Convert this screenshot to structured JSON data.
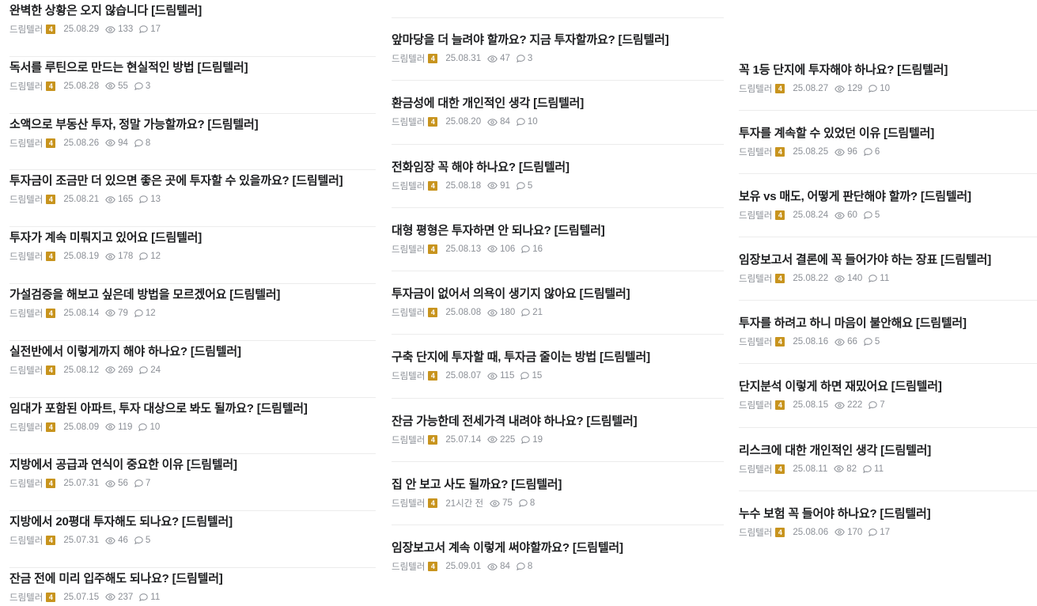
{
  "colors": {
    "title": "#1d1e20",
    "meta": "#8b8f96",
    "level_badge": "#c8941e",
    "divider": "#ececec"
  },
  "icons": {
    "views": "eye-icon",
    "comments": "comment-bubble-icon"
  },
  "columns": [
    {
      "posts": [
        {
          "title": "완벽한 상황은 오지 않습니다 [드림텔러]",
          "author": "드림텔러",
          "level": "4",
          "date": "25.08.29",
          "views": "133",
          "comments": "17"
        },
        {
          "title": "독서를 루틴으로 만드는 현실적인 방법 [드림텔러]",
          "author": "드림텔러",
          "level": "4",
          "date": "25.08.28",
          "views": "55",
          "comments": "3"
        },
        {
          "title": "소액으로 부동산 투자, 정말 가능할까요? [드림텔러]",
          "author": "드림텔러",
          "level": "4",
          "date": "25.08.26",
          "views": "94",
          "comments": "8"
        },
        {
          "title": "투자금이 조금만 더 있으면 좋은 곳에 투자할 수 있을까요? [드림텔러]",
          "author": "드림텔러",
          "level": "4",
          "date": "25.08.21",
          "views": "165",
          "comments": "13"
        },
        {
          "title": "투자가 계속 미뤄지고 있어요 [드림텔러]",
          "author": "드림텔러",
          "level": "4",
          "date": "25.08.19",
          "views": "178",
          "comments": "12"
        },
        {
          "title": "가설검증을 해보고 싶은데 방법을 모르겠어요 [드림텔러]",
          "author": "드림텔러",
          "level": "4",
          "date": "25.08.14",
          "views": "79",
          "comments": "12"
        },
        {
          "title": "실전반에서 이렇게까지 해야 하나요? [드림텔러]",
          "author": "드림텔러",
          "level": "4",
          "date": "25.08.12",
          "views": "269",
          "comments": "24"
        },
        {
          "title": "임대가 포함된 아파트, 투자 대상으로 봐도 될까요? [드림텔러]",
          "author": "드림텔러",
          "level": "4",
          "date": "25.08.09",
          "views": "119",
          "comments": "10"
        },
        {
          "title": "지방에서 공급과 연식이 중요한 이유 [드림텔러]",
          "author": "드림텔러",
          "level": "4",
          "date": "25.07.31",
          "views": "56",
          "comments": "7"
        },
        {
          "title": "지방에서 20평대 투자해도 되나요? [드림텔러]",
          "author": "드림텔러",
          "level": "4",
          "date": "25.07.31",
          "views": "46",
          "comments": "5"
        },
        {
          "title": "잔금 전에 미리 입주해도 되나요? [드림텔러]",
          "author": "드림텔러",
          "level": "4",
          "date": "25.07.15",
          "views": "237",
          "comments": "11"
        }
      ]
    },
    {
      "posts": [
        {
          "title": "앞마당을 더 늘려야 할까요? 지금 투자할까요? [드림텔러]",
          "author": "드림텔러",
          "level": "4",
          "date": "25.08.31",
          "views": "47",
          "comments": "3"
        },
        {
          "title": "환금성에 대한 개인적인 생각 [드림텔러]",
          "author": "드림텔러",
          "level": "4",
          "date": "25.08.20",
          "views": "84",
          "comments": "10"
        },
        {
          "title": "전화임장 꼭 해야 하나요? [드림텔러]",
          "author": "드림텔러",
          "level": "4",
          "date": "25.08.18",
          "views": "91",
          "comments": "5"
        },
        {
          "title": "대형 평형은 투자하면 안 되나요? [드림텔러]",
          "author": "드림텔러",
          "level": "4",
          "date": "25.08.13",
          "views": "106",
          "comments": "16"
        },
        {
          "title": "투자금이 없어서 의욕이 생기지 않아요 [드림텔러]",
          "author": "드림텔러",
          "level": "4",
          "date": "25.08.08",
          "views": "180",
          "comments": "21"
        },
        {
          "title": "구축 단지에 투자할 때, 투자금 줄이는 방법 [드림텔러]",
          "author": "드림텔러",
          "level": "4",
          "date": "25.08.07",
          "views": "115",
          "comments": "15"
        },
        {
          "title": "잔금 가능한데 전세가격 내려야 하나요? [드림텔러]",
          "author": "드림텔러",
          "level": "4",
          "date": "25.07.14",
          "views": "225",
          "comments": "19"
        },
        {
          "title": "집 안 보고 사도 될까요? [드림텔러]",
          "author": "드림텔러",
          "level": "4",
          "date": "21시간 전",
          "views": "75",
          "comments": "8"
        },
        {
          "title": "임장보고서 계속 이렇게 써야할까요? [드림텔러]",
          "author": "드림텔러",
          "level": "4",
          "date": "25.09.01",
          "views": "84",
          "comments": "8"
        }
      ]
    },
    {
      "posts": [
        {
          "title": "꼭 1등 단지에 투자해야 하나요? [드림텔러]",
          "author": "드림텔러",
          "level": "4",
          "date": "25.08.27",
          "views": "129",
          "comments": "10"
        },
        {
          "title": "투자를 계속할 수 있었던 이유 [드림텔러]",
          "author": "드림텔러",
          "level": "4",
          "date": "25.08.25",
          "views": "96",
          "comments": "6"
        },
        {
          "title": "보유 vs 매도, 어떻게 판단해야 할까? [드림텔러]",
          "author": "드림텔러",
          "level": "4",
          "date": "25.08.24",
          "views": "60",
          "comments": "5"
        },
        {
          "title": "임장보고서 결론에 꼭 들어가야 하는 장표 [드림텔러]",
          "author": "드림텔러",
          "level": "4",
          "date": "25.08.22",
          "views": "140",
          "comments": "11"
        },
        {
          "title": "투자를 하려고 하니 마음이 불안해요 [드림텔러]",
          "author": "드림텔러",
          "level": "4",
          "date": "25.08.16",
          "views": "66",
          "comments": "5"
        },
        {
          "title": "단지분석 이렇게 하면 재밌어요 [드림텔러]",
          "author": "드림텔러",
          "level": "4",
          "date": "25.08.15",
          "views": "222",
          "comments": "7"
        },
        {
          "title": "리스크에 대한 개인적인 생각 [드림텔러]",
          "author": "드림텔러",
          "level": "4",
          "date": "25.08.11",
          "views": "82",
          "comments": "11"
        },
        {
          "title": "누수 보험 꼭 들어야 하나요? [드림텔러]",
          "author": "드림텔러",
          "level": "4",
          "date": "25.08.06",
          "views": "170",
          "comments": "17"
        }
      ]
    }
  ]
}
